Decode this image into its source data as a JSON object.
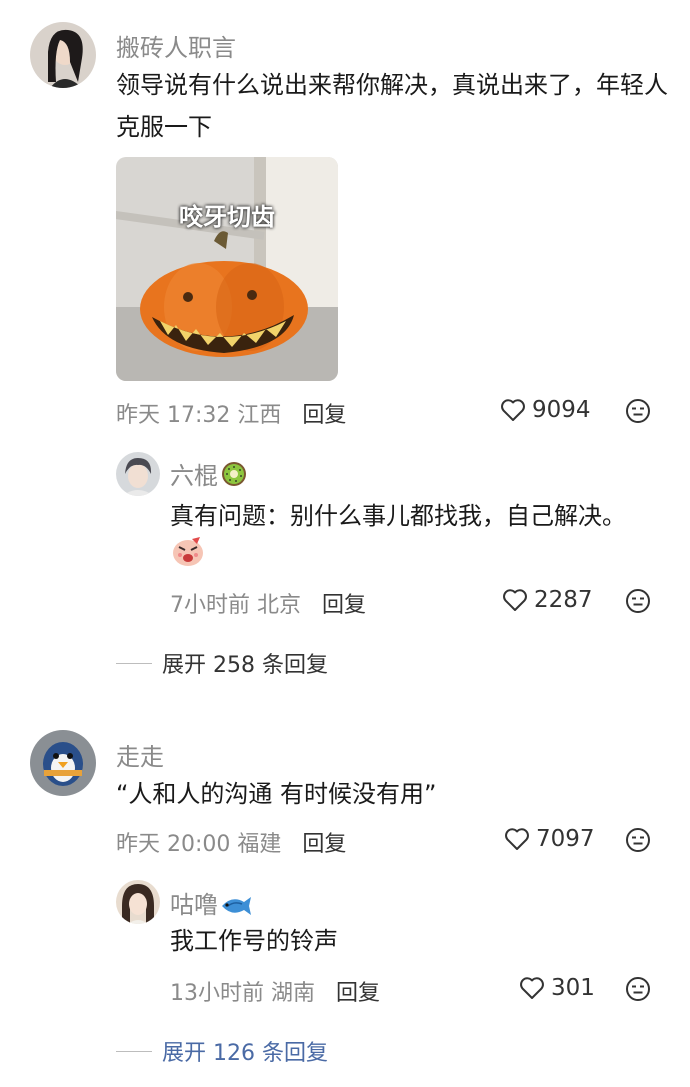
{
  "comments": [
    {
      "username": "搬砖人职言",
      "text": "领导说有什么说出来帮你解决，真说出来了，年轻人克服一下",
      "image_caption": "咬牙切齿",
      "time": "昨天 17:32",
      "location": "江西",
      "reply_label": "回复",
      "likes": "9094",
      "replies": [
        {
          "username": "六棍",
          "name_emoji": "kiwi-icon",
          "text": "真有问题：别什么事儿都找我，自己解决。",
          "sticker": "angry-face-sticker",
          "time": "7小时前",
          "location": "北京",
          "reply_label": "回复",
          "likes": "2287"
        }
      ],
      "expand_label": "展开 258 条回复"
    },
    {
      "username": "走走",
      "text": "“人和人的沟通 有时候没有用”",
      "time": "昨天 20:00",
      "location": "福建",
      "reply_label": "回复",
      "likes": "7097",
      "replies": [
        {
          "username": "咕噜",
          "name_emoji": "fish-icon",
          "text": "我工作号的铃声",
          "time": "13小时前",
          "location": "湖南",
          "reply_label": "回复",
          "likes": "301"
        }
      ],
      "expand_label": "展开 126 条回复"
    }
  ],
  "colors": {
    "meta_gray": "#8a8a8a",
    "expand_blue": "#4a6aa5",
    "pumpkin_orange": "#e8741e"
  }
}
